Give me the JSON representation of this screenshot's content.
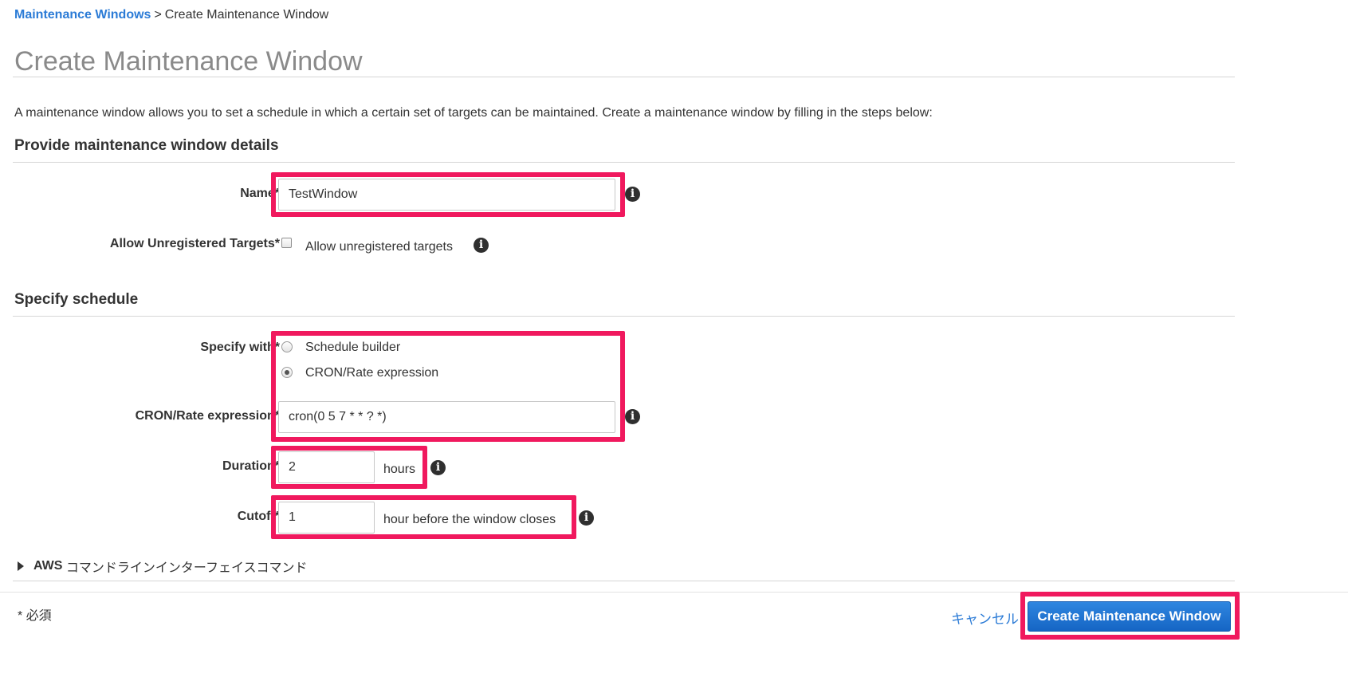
{
  "breadcrumb": {
    "parent": "Maintenance Windows",
    "separator": ">",
    "current": "Create Maintenance Window"
  },
  "page_title": "Create Maintenance Window",
  "intro": "A maintenance window allows you to set a schedule in which a certain set of targets can be maintained. Create a maintenance window by filling in the steps below:",
  "details": {
    "section_title": "Provide maintenance window details",
    "name_label": "Name*",
    "name_value": "TestWindow",
    "unregistered_label": "Allow Unregistered Targets*",
    "unregistered_option": "Allow unregistered targets",
    "unregistered_checked": false
  },
  "schedule": {
    "section_title": "Specify schedule",
    "specify_with_label": "Specify with*",
    "options": [
      "Schedule builder",
      "CRON/Rate expression"
    ],
    "selected_option": "CRON/Rate expression",
    "cron_label": "CRON/Rate expression*",
    "cron_value": "cron(0 5 7 * * ? *)",
    "duration_label": "Duration*",
    "duration_value": "2",
    "duration_unit": "hours",
    "cutoff_label": "Cutoff*",
    "cutoff_value": "1",
    "cutoff_unit": "hour before the window closes"
  },
  "cli_expander": {
    "bold": "AWS",
    "rest": " コマンドラインインターフェイスコマンド"
  },
  "footer": {
    "required_note": "* 必須",
    "cancel_label": "キャンセル",
    "submit_label": "Create Maintenance Window"
  },
  "icons": {
    "info": "info-icon",
    "expander": "caret-right-icon"
  },
  "colors": {
    "link": "#2b7bd6",
    "highlight": "#f0195e",
    "primary_button": "#1f73d2",
    "title_gray": "#8a8a8a"
  }
}
